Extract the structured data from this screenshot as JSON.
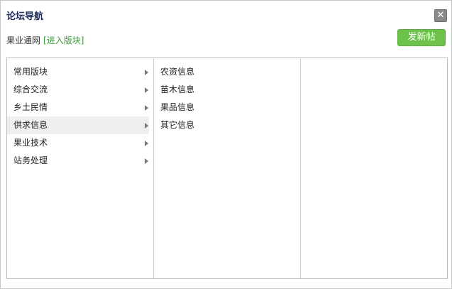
{
  "dialog": {
    "title": "论坛导航",
    "close_glyph": "✕",
    "forum_name": "果业通网",
    "enter_link": "[进入版块]",
    "post_button": "发新帖"
  },
  "categories": [
    {
      "label": "常用版块"
    },
    {
      "label": "综合交流"
    },
    {
      "label": "乡土民情"
    },
    {
      "label": "供求信息"
    },
    {
      "label": "果业技术"
    },
    {
      "label": "站务处理"
    }
  ],
  "subforums": [
    {
      "label": "农资信息"
    },
    {
      "label": "苗木信息"
    },
    {
      "label": "果品信息"
    },
    {
      "label": "其它信息"
    }
  ],
  "colors": {
    "accent": "#6cc24a",
    "title": "#1a2a5c",
    "link": "#3a9a3a"
  }
}
